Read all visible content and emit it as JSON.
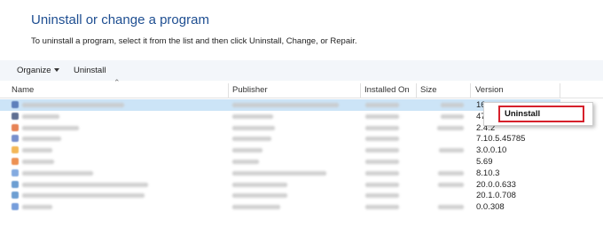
{
  "header": {
    "title": "Uninstall or change a program",
    "description": "To uninstall a program, select it from the list and then click Uninstall, Change, or Repair."
  },
  "toolbar": {
    "organize_label": "Organize",
    "uninstall_label": "Uninstall"
  },
  "columns": {
    "name": "Name",
    "publisher": "Publisher",
    "installed_on": "Installed On",
    "size": "Size",
    "version": "Version"
  },
  "rows": [
    {
      "version": "16",
      "selected": true,
      "icon_color": "#3a5fa8"
    },
    {
      "version": "47",
      "selected": false,
      "icon_color": "#2a3f6e"
    },
    {
      "version": "2.4.2",
      "selected": false,
      "icon_color": "#e05a1e"
    },
    {
      "version": "7.10.5.45785",
      "selected": false,
      "icon_color": "#4c6bbd"
    },
    {
      "version": "3.0.0.10",
      "selected": false,
      "icon_color": "#f0a020"
    },
    {
      "version": "5.69",
      "selected": false,
      "icon_color": "#e86d1a"
    },
    {
      "version": "8.10.3",
      "selected": false,
      "icon_color": "#5b8fd6"
    },
    {
      "version": "20.0.0.633",
      "selected": false,
      "icon_color": "#3e7fc4"
    },
    {
      "version": "20.1.0.708",
      "selected": false,
      "icon_color": "#3e7fc4"
    },
    {
      "version": "0.0.308",
      "selected": false,
      "icon_color": "#4a7ed0"
    }
  ],
  "context_menu": {
    "uninstall_label": "Uninstall",
    "highlight_color": "#d6202b"
  }
}
